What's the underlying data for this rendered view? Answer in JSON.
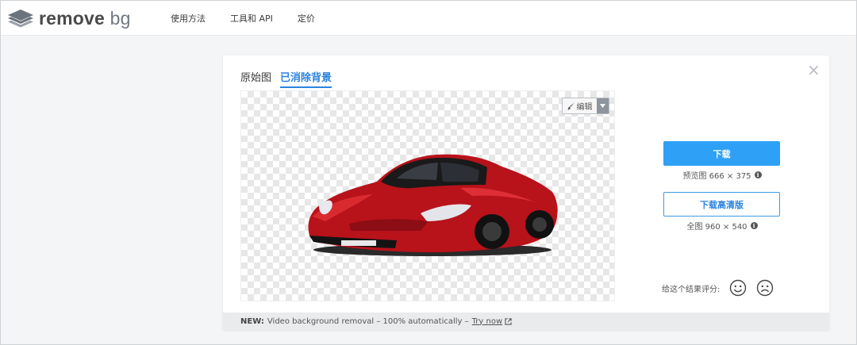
{
  "brand": {
    "name_bold": "remove",
    "name_light": "bg"
  },
  "nav": {
    "items": [
      "使用方法",
      "工具和 API",
      "定价"
    ]
  },
  "card": {
    "tabs": [
      {
        "label": "原始图",
        "active": false
      },
      {
        "label": "已消除背景",
        "active": true
      }
    ],
    "close_icon": "close-icon",
    "edit_label": "编辑",
    "download": {
      "button_label": "下载",
      "preview_text": "预览图 666 × 375",
      "hd_button_label": "下载高清版",
      "full_text": "全图 960 × 540"
    },
    "rating": {
      "label": "给这个结果评分:",
      "icons": [
        "happy-face-icon",
        "sad-face-icon"
      ]
    },
    "footer": {
      "new_label": "NEW:",
      "text": "Video background removal – 100% automatically –",
      "link_label": "Try now"
    }
  },
  "colors": {
    "accent": "#2ea0f5",
    "link": "#2c83e0",
    "car_red": "#c0121c"
  }
}
